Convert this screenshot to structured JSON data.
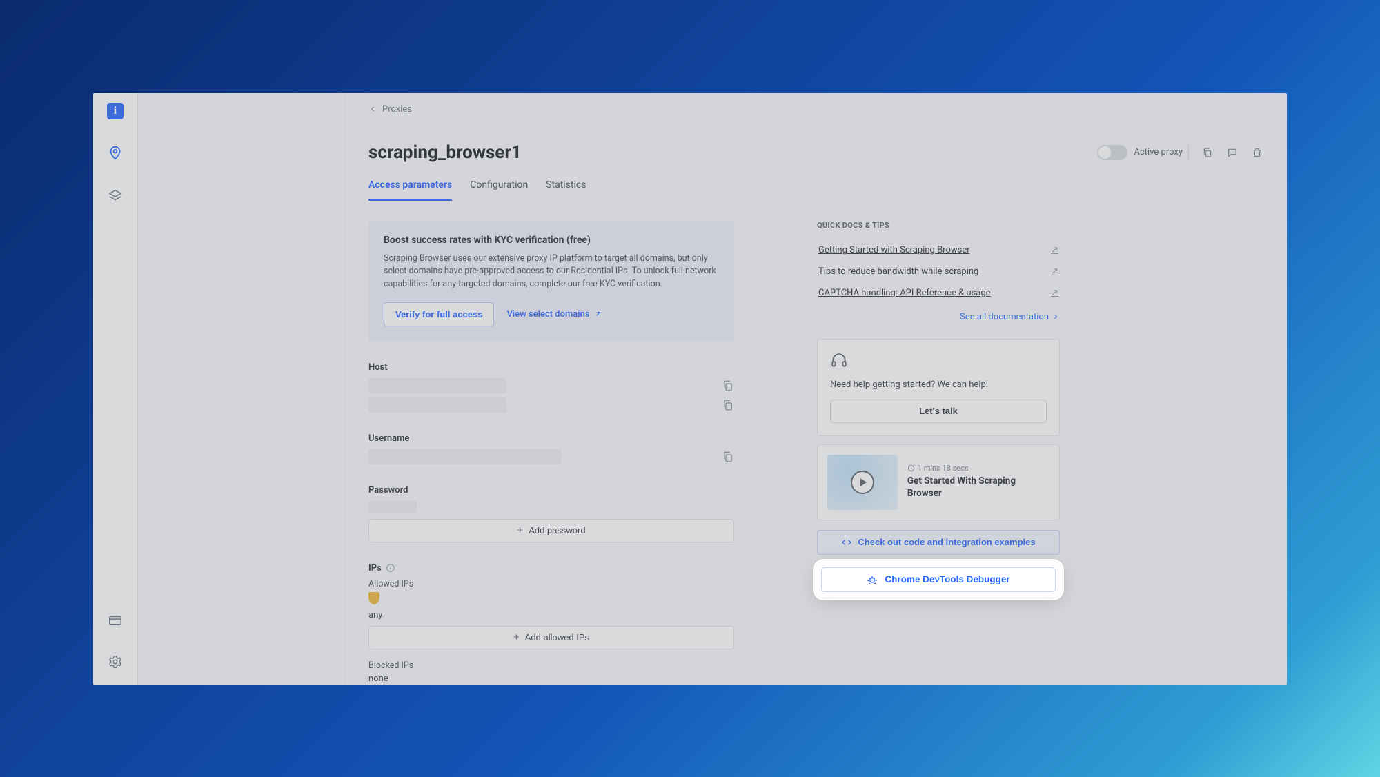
{
  "breadcrumb": {
    "label": "Proxies"
  },
  "page": {
    "title": "scraping_browser1"
  },
  "tabs": [
    {
      "label": "Access parameters",
      "active": true
    },
    {
      "label": "Configuration",
      "active": false
    },
    {
      "label": "Statistics",
      "active": false
    }
  ],
  "title_actions": {
    "toggle_label": "Active proxy"
  },
  "kyc": {
    "title": "Boost success rates with KYC verification (free)",
    "text": "Scraping Browser uses our extensive proxy IP platform to target all domains, but only select domains have pre-approved access to our Residential IPs. To unlock full network capabilities for any targeted domains, complete our free KYC verification.",
    "verify_btn": "Verify for full access",
    "view_link": "View select domains"
  },
  "fields": {
    "host_label": "Host",
    "username_label": "Username",
    "password_label": "Password",
    "add_password": "Add password",
    "ips_label": "IPs",
    "allowed_label": "Allowed IPs",
    "allowed_value": "any",
    "add_allowed": "Add allowed IPs",
    "blocked_label": "Blocked IPs",
    "blocked_value": "none"
  },
  "docs": {
    "section_title": "QUICK DOCS & TIPS",
    "links": [
      "Getting Started with Scraping Browser",
      "Tips to reduce bandwidth while scraping",
      "CAPTCHA handling: API Reference & usage"
    ],
    "see_all": "See all documentation"
  },
  "help": {
    "text": "Need help getting started? We can help!",
    "btn": "Let's talk"
  },
  "video": {
    "duration": "1 mins 18 secs",
    "title": "Get Started With Scraping Browser"
  },
  "buttons": {
    "code_examples": "Check out code and integration examples",
    "devtools": "Chrome DevTools Debugger"
  }
}
